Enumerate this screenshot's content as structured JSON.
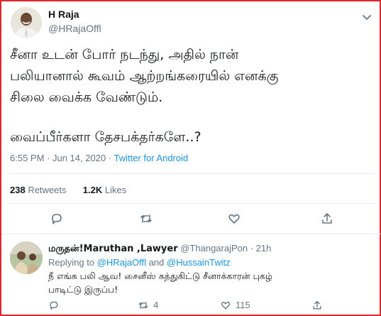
{
  "tweet": {
    "author_name": "H Raja",
    "author_handle": "@HRajaOffl",
    "text_lines": [
      "சீனா உடன் போர் நடந்து, அதில் நான்",
      "பலியானால் கூவம் ஆற்றங்கரையில் எனக்கு",
      "சிலை வைக்க வேண்டும்.",
      "வைப்பீர்களா தேசபக்தர்களே..?"
    ],
    "timestamp": "6:55 PM · Jun 14, 2020 · ",
    "source": "Twitter for Android",
    "retweets_count": "238",
    "retweets_label": " Retweets",
    "likes_count": "1.2K",
    "likes_label": " Likes"
  },
  "icons": {
    "more": "chevron-down-icon",
    "reply": "comment-icon",
    "retweet": "retweet-icon",
    "like": "heart-icon",
    "share": "share-icon"
  },
  "reply": {
    "author_name": "மருதன்!Maruthan ,Lawyer",
    "author_handle": " @ThangarajPon · 21h",
    "replying_prefix": "Replying to ",
    "replying_to_1": "@HRajaOffl",
    "replying_and": " and ",
    "replying_to_2": "@HussainTwitz",
    "text_lines": [
      "நீ எங்க பலி ஆவ! சைனீஸ் கத்துகிட்டு சீனாக்காரன் புகழ்",
      "பாடிட்டு இருப்ப!"
    ],
    "retweets_count": "4",
    "likes_count": "115"
  },
  "colors": {
    "frame_border": "#e0252b",
    "accent_link": "#1b95e0",
    "muted_text": "#657786",
    "divider": "#e6ecf0"
  }
}
